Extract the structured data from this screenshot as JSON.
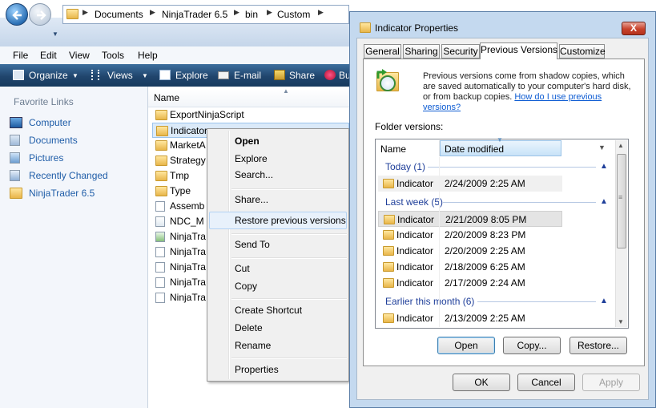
{
  "explorer": {
    "breadcrumb": [
      "Documents",
      "NinjaTrader 6.5",
      "bin",
      "Custom"
    ],
    "menu": [
      "File",
      "Edit",
      "View",
      "Tools",
      "Help"
    ],
    "toolbar": [
      "Organize",
      "Views",
      "Explore",
      "E-mail",
      "Share",
      "Bu"
    ],
    "favorites_title": "Favorite Links",
    "favorites": [
      "Computer",
      "Documents",
      "Pictures",
      "Recently Changed",
      "NinjaTrader 6.5"
    ],
    "column_name": "Name",
    "files": [
      "ExportNinjaScript",
      "Indicator",
      "MarketA",
      "Strategy",
      "Tmp",
      "Type",
      "Assemb",
      "NDC_M",
      "NinjaTra",
      "NinjaTra",
      "NinjaTra",
      "NinjaTra",
      "NinjaTra"
    ]
  },
  "context_menu": {
    "open": "Open",
    "explore": "Explore",
    "search": "Search...",
    "share": "Share...",
    "restore": "Restore previous versions",
    "send_to": "Send To",
    "cut": "Cut",
    "copy": "Copy",
    "create_shortcut": "Create Shortcut",
    "delete": "Delete",
    "rename": "Rename",
    "properties": "Properties"
  },
  "dialog": {
    "title": "Indicator Properties",
    "close_glyph": "X",
    "tabs": [
      "General",
      "Sharing",
      "Security",
      "Previous Versions",
      "Customize"
    ],
    "description": "Previous versions come from shadow copies, which are saved automatically to your computer's hard disk, or from backup copies.",
    "help_link": "How do I use previous versions?",
    "folder_versions_label": "Folder versions:",
    "col_name": "Name",
    "col_date": "Date modified",
    "groups": [
      {
        "label": "Today (1)",
        "rows": [
          {
            "name": "Indicator",
            "date": "2/24/2009 2:25 AM"
          }
        ]
      },
      {
        "label": "Last week (5)",
        "rows": [
          {
            "name": "Indicator",
            "date": "2/21/2009 8:05 PM"
          },
          {
            "name": "Indicator",
            "date": "2/20/2009 8:23 PM"
          },
          {
            "name": "Indicator",
            "date": "2/20/2009 2:25 AM"
          },
          {
            "name": "Indicator",
            "date": "2/18/2009 6:25 AM"
          },
          {
            "name": "Indicator",
            "date": "2/17/2009 2:24 AM"
          }
        ]
      },
      {
        "label": "Earlier this month (6)",
        "rows": [
          {
            "name": "Indicator",
            "date": "2/13/2009 2:25 AM"
          }
        ]
      }
    ],
    "buttons": {
      "open": "Open",
      "copy": "Copy...",
      "restore": "Restore...",
      "ok": "OK",
      "cancel": "Cancel",
      "apply": "Apply"
    }
  }
}
